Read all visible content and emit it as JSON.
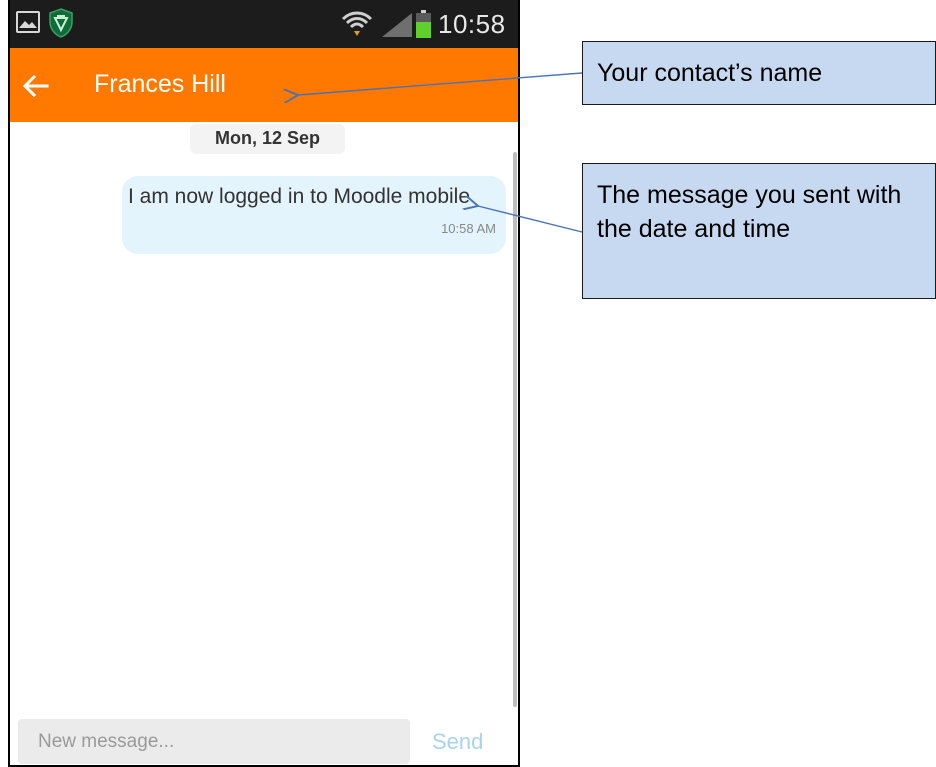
{
  "status_bar": {
    "time": "10:58",
    "icons": [
      "gallery-icon",
      "shield-icon",
      "wifi-icon",
      "signal-icon",
      "battery-icon"
    ]
  },
  "app_bar": {
    "back_icon": "arrow-left-icon",
    "contact_name": "Frances Hill"
  },
  "conversation": {
    "date_label": "Mon, 12 Sep",
    "messages": [
      {
        "text": "I am now logged in to Moodle mobile",
        "time": "10:58 AM",
        "direction": "sent"
      }
    ]
  },
  "composer": {
    "placeholder": "New message...",
    "send_label": "Send"
  },
  "annotations": {
    "contact_name_note": "Your contact’s name",
    "message_note": "The message you sent with the date and time"
  },
  "colors": {
    "app_bar": "#ff7800",
    "status_bar": "#1c1c1c",
    "bubble": "#e3f4fc",
    "callout": "#c6d9f1",
    "send": "#a9d3ec",
    "arrow": "#4a74b4"
  }
}
